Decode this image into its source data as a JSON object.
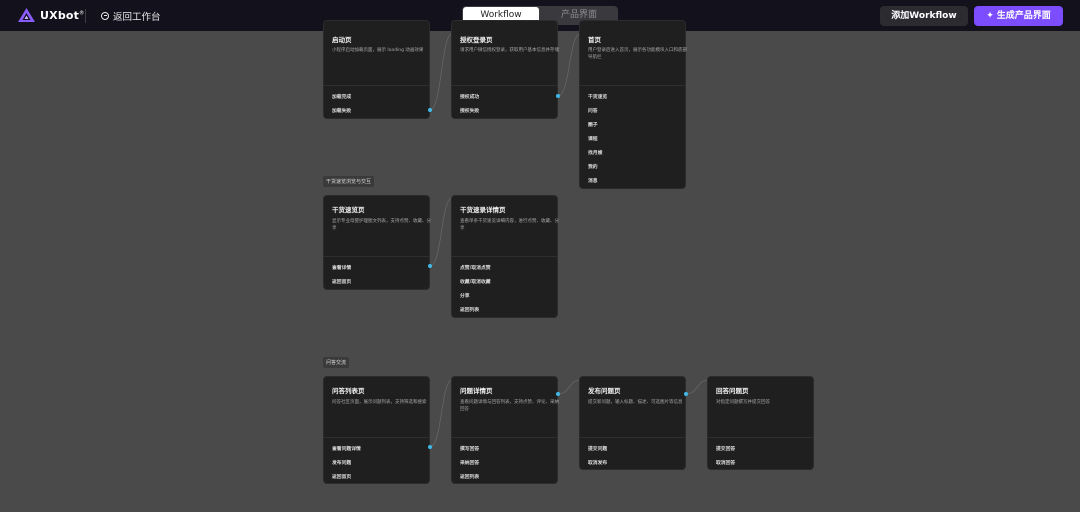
{
  "header": {
    "logo_text": "UXbot",
    "logo_superscript": "®",
    "back_label": "返回工作台",
    "tabs": [
      {
        "label": "Workflow",
        "active": true
      },
      {
        "label": "产品界面",
        "active": false
      }
    ],
    "add_workflow_label": "添加Workflow",
    "generate_label": "生成产品界面",
    "accent_color": "#7b4dff"
  },
  "groups": [
    {
      "label": "干货速览浏览与交互"
    },
    {
      "label": "问答交流"
    }
  ],
  "cards": [
    {
      "title": "启动页",
      "desc": "小程序启动加载页面，展示 loading 动画效果",
      "actions": [
        "加载完成",
        "加载失败"
      ]
    },
    {
      "title": "授权登录页",
      "desc": "请求用户微信授权登录，获取用户基本信息并存储",
      "actions": [
        "授权成功",
        "授权失败"
      ]
    },
    {
      "title": "首页",
      "desc": "用户登录后进入首页，展示各功能模块入口和底部导航栏",
      "actions": [
        "干货速览",
        "问答",
        "圈子",
        "课程",
        "找月嫂",
        "我的",
        "消息"
      ]
    },
    {
      "title": "干货速览页",
      "desc": "显示专业母婴护理图文列表，支持点赞、收藏、分享",
      "actions": [
        "查看详情",
        "返回首页"
      ]
    },
    {
      "title": "干货速录详情页",
      "desc": "查看单条干货速览详细内容，进行点赞、收藏、分享",
      "actions": [
        "点赞/取消点赞",
        "收藏/取消收藏",
        "分享",
        "返回列表"
      ]
    },
    {
      "title": "问答列表页",
      "desc": "问答社区页面，展示问题列表，支持筛选和搜索",
      "actions": [
        "查看问题详情",
        "发布问题",
        "返回首页"
      ]
    },
    {
      "title": "问题详情页",
      "desc": "查看问题详情与回答列表，支持点赞、评论、采纳回答",
      "actions": [
        "撰写回答",
        "采纳回答",
        "返回列表"
      ]
    },
    {
      "title": "发布问题页",
      "desc": "提交新问题，输入标题、描述、可选图片等信息",
      "actions": [
        "提交问题",
        "取消发布"
      ]
    },
    {
      "title": "回答问题页",
      "desc": "对指定问题撰写并提交回答",
      "actions": [
        "提交回答",
        "取消回答"
      ]
    }
  ]
}
